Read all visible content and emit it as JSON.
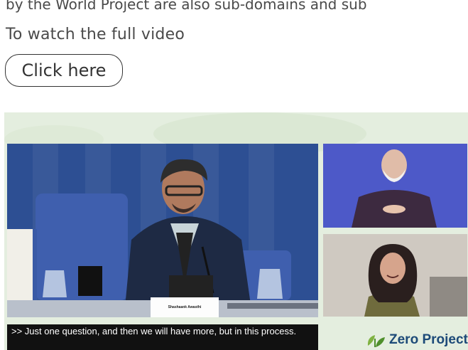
{
  "page": {
    "truncated_text": "by the World Project are also sub-domains and sub",
    "watch_label": "To watch the full video",
    "button_label": "Click here"
  },
  "video": {
    "caption": ">> Just one question, and then we will have more, but in this process.",
    "nameplate": "Shashaank Awasthi",
    "logo_text": "Zero Project"
  },
  "colors": {
    "video_bg": "#e4eedf",
    "main_feed_bg": "#2d4f93",
    "side_feed_bg": "#4d59c8",
    "logo_text": "#1d4a78"
  }
}
